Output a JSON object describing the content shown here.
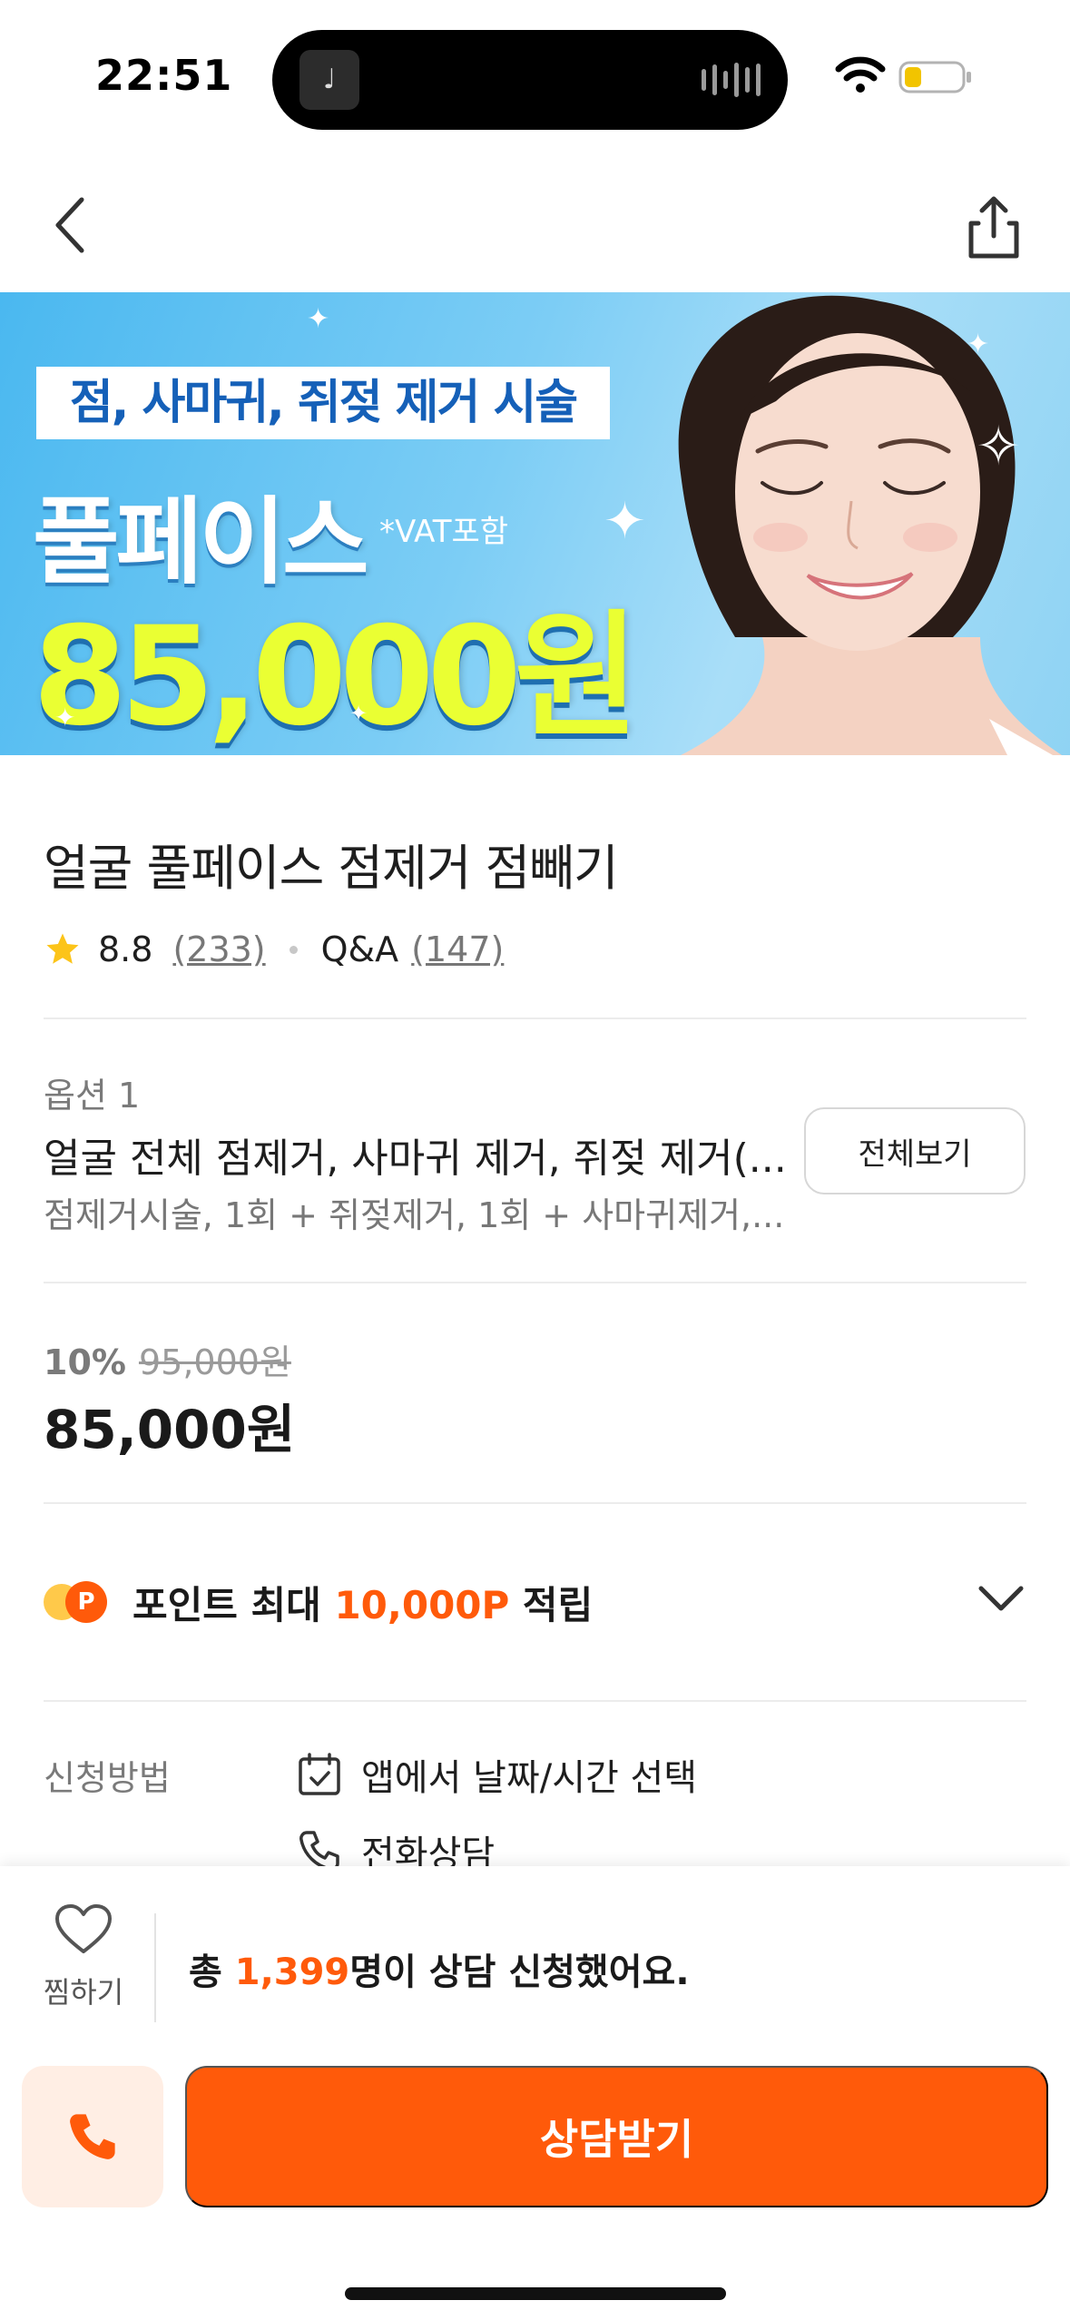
{
  "status_bar": {
    "time": "22:51"
  },
  "banner": {
    "tag": "점, 사마귀, 쥐젖 제거 시술",
    "title": "풀페이스",
    "vat_note": "*VAT포함",
    "price": "85,000원"
  },
  "product": {
    "title": "얼굴 풀페이스 점제거 점빼기",
    "rating": "8.8",
    "review_count": "(233)",
    "qa_label": "Q&A",
    "qa_count": "(147)"
  },
  "option": {
    "label": "옵션 1",
    "name": "얼굴 전체 점제거, 사마귀 제거, 쥐젖 제거(...",
    "description": "점제거시술, 1회 + 쥐젖제거, 1회 + 사마귀제거,...",
    "view_all_label": "전체보기"
  },
  "pricing": {
    "discount_rate": "10%",
    "original_price": "95,000원",
    "final_price": "85,000원"
  },
  "points": {
    "prefix": "포인트 최대 ",
    "amount": "10,000P",
    "suffix": " 적립",
    "icon_letter": "P"
  },
  "application": {
    "label": "신청방법",
    "methods": [
      "앱에서 날짜/시간 선택",
      "전화상담"
    ]
  },
  "bottom_bar": {
    "wishlist_label": "찜하기",
    "consult_prefix": "총 ",
    "consult_count": "1,399",
    "consult_suffix": "명이 상담 신청했어요.",
    "consult_button": "상담받기"
  },
  "colors": {
    "accent": "#ff5a0a",
    "accent_light": "#ffeee4",
    "banner_price": "#eaff33"
  }
}
